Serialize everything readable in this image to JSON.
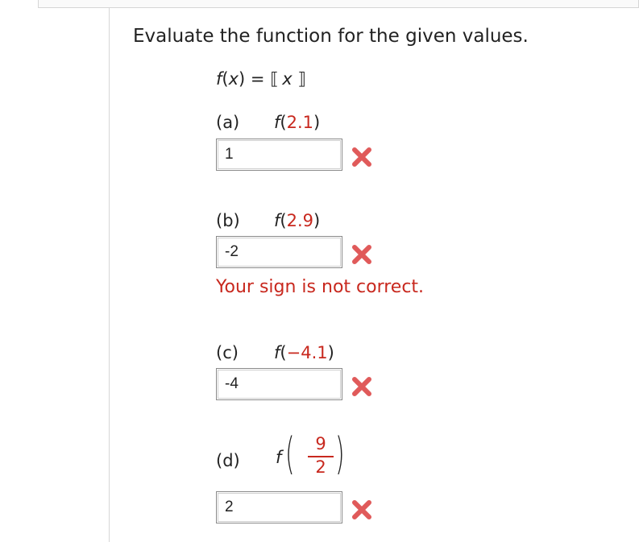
{
  "instruction": "Evaluate the function for the given values.",
  "function_def": {
    "name": "f",
    "var": "x",
    "equals": " = ",
    "open_bracket": "⟦",
    "close_bracket": "⟧"
  },
  "parts": [
    {
      "tag": "(a)",
      "func": "f",
      "arg": "2.1",
      "answer": "1",
      "status": "incorrect"
    },
    {
      "tag": "(b)",
      "func": "f",
      "arg": "2.9",
      "answer": "-2",
      "status": "incorrect",
      "feedback": "Your sign is not correct."
    },
    {
      "tag": "(c)",
      "func": "f",
      "arg": "−4.1",
      "answer": "-4",
      "status": "incorrect"
    },
    {
      "tag": "(d)",
      "func": "f",
      "arg_numerator": "9",
      "arg_denominator": "2",
      "answer": "2",
      "status": "incorrect"
    }
  ],
  "icons": {
    "incorrect": "x-mark-icon"
  },
  "colors": {
    "error": "#c8281e",
    "x_mark": "#e05a5a",
    "border": "#8a8a8a"
  }
}
